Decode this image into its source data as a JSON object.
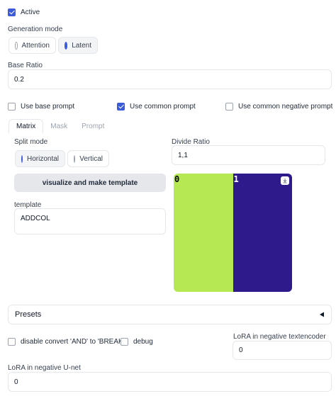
{
  "active": {
    "label": "Active",
    "checked": true
  },
  "generation_mode": {
    "label": "Generation mode",
    "options": [
      "Attention",
      "Latent"
    ],
    "selected": "Latent"
  },
  "base_ratio": {
    "label": "Base Ratio",
    "value": "0.2"
  },
  "prompt_options": {
    "use_base_prompt": {
      "label": "Use base prompt",
      "checked": false
    },
    "use_common_prompt": {
      "label": "Use common prompt",
      "checked": true
    },
    "use_common_negative_prompt": {
      "label": "Use common negative prompt",
      "checked": false
    }
  },
  "tabs": [
    {
      "label": "Matrix",
      "active": true
    },
    {
      "label": "Mask",
      "active": false
    },
    {
      "label": "Prompt",
      "active": false
    }
  ],
  "matrix": {
    "split_mode": {
      "label": "Split mode",
      "options": [
        "Horizontal",
        "Vertical"
      ],
      "selected": "Horizontal"
    },
    "visualize_button": "visualize and make template",
    "template": {
      "label": "template",
      "value": "ADDCOL"
    },
    "divide_ratio": {
      "label": "Divide Ratio",
      "value": "1,1"
    },
    "preview": {
      "regions": [
        {
          "label": "0",
          "color": "#b5e853",
          "text_color": "#000000",
          "ratio": 1
        },
        {
          "label": "1",
          "color": "#2e1a8b",
          "text_color": "#ffffff",
          "ratio": 1
        }
      ],
      "download_icon": "download-icon"
    }
  },
  "presets": {
    "label": "Presets",
    "icon": "triangle-left-icon"
  },
  "bottom": {
    "disable_convert": {
      "label": "disable convert 'AND' to 'BREAK'",
      "checked": false
    },
    "debug": {
      "label": "debug",
      "checked": false
    },
    "lora_neg_textencoder": {
      "label": "LoRA in negative textencoder",
      "value": "0"
    },
    "lora_neg_unet": {
      "label": "LoRA in negative U-net",
      "value": "0"
    }
  },
  "colors": {
    "accent": "#3b5bdb"
  }
}
